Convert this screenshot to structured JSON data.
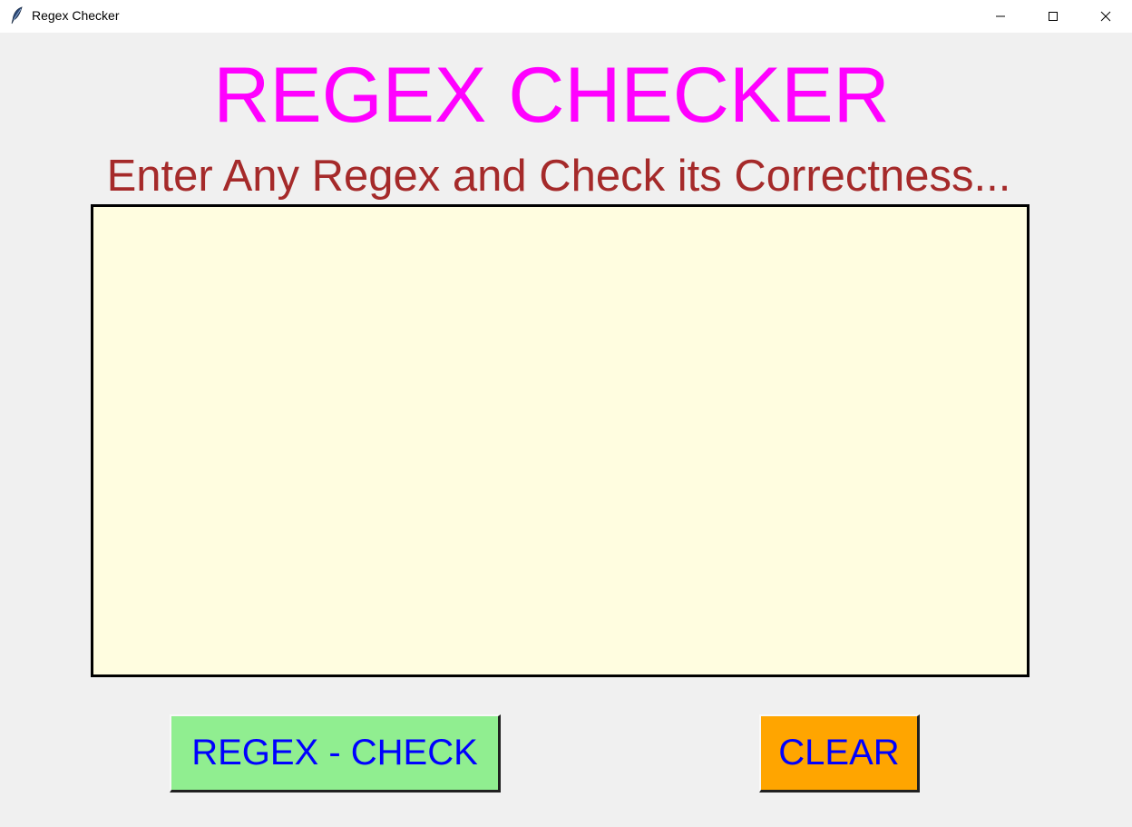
{
  "window": {
    "title": "Regex Checker",
    "icon": "feather-icon"
  },
  "main": {
    "heading": "REGEX CHECKER",
    "subheading": "Enter Any Regex and Check its Correctness...",
    "input_value": ""
  },
  "buttons": {
    "check_label": "REGEX - CHECK",
    "clear_label": "CLEAR"
  },
  "colors": {
    "heading": "#ff00ff",
    "subheading": "#a52a2a",
    "input_bg": "#fffde0",
    "check_bg": "#90ee90",
    "clear_bg": "#ffa500",
    "button_text": "#0000ff"
  }
}
